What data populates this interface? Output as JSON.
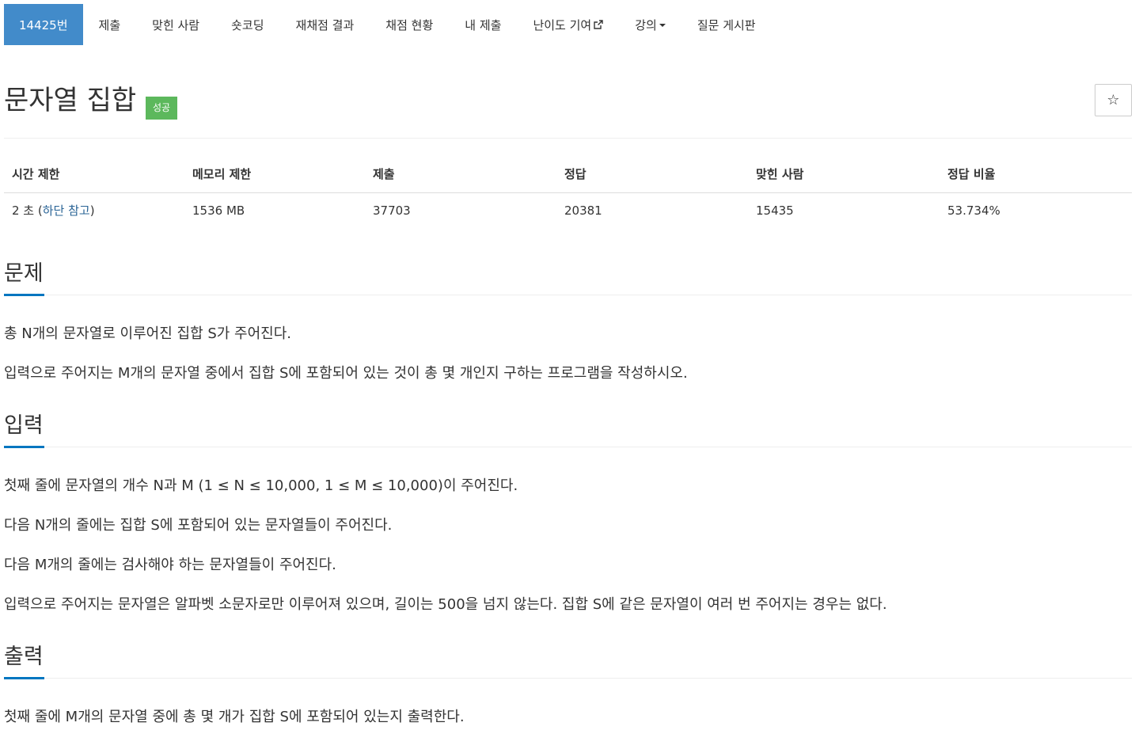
{
  "nav": {
    "tabs": [
      {
        "label": "14425번"
      },
      {
        "label": "제출"
      },
      {
        "label": "맞힌 사람"
      },
      {
        "label": "숏코딩"
      },
      {
        "label": "재채점 결과"
      },
      {
        "label": "채점 현황"
      },
      {
        "label": "내 제출"
      },
      {
        "label": "난이도 기여"
      },
      {
        "label": "강의"
      },
      {
        "label": "질문 게시판"
      }
    ],
    "accent_color": "#428bca"
  },
  "problem": {
    "title": "문자열 집합",
    "status_badge": "성공",
    "badge_color": "#5cb85c",
    "star_icon": "star-outline-icon",
    "star_glyph": "☆"
  },
  "info": {
    "headers": [
      "시간 제한",
      "메모리 제한",
      "제출",
      "정답",
      "맞힌 사람",
      "정답 비율"
    ],
    "time_limit_prefix": "2 초 (",
    "time_limit_link": "하단 참고",
    "time_limit_suffix": ")",
    "memory_limit": "1536 MB",
    "submissions": "37703",
    "accepted": "20381",
    "solvers": "15435",
    "ratio": "53.734%"
  },
  "sections": {
    "description": {
      "heading": "문제",
      "paragraphs": [
        "총 N개의 문자열로 이루어진 집합 S가 주어진다.",
        "입력으로 주어지는 M개의 문자열 중에서 집합 S에 포함되어 있는 것이 총 몇 개인지 구하는 프로그램을 작성하시오."
      ]
    },
    "input": {
      "heading": "입력",
      "paragraphs": [
        "첫째 줄에 문자열의 개수 N과 M (1 ≤ N ≤ 10,000, 1 ≤ M ≤ 10,000)이 주어진다.",
        "다음 N개의 줄에는 집합 S에 포함되어 있는 문자열들이 주어진다.",
        "다음 M개의 줄에는 검사해야 하는 문자열들이 주어진다.",
        "입력으로 주어지는 문자열은 알파벳 소문자로만 이루어져 있으며, 길이는 500을 넘지 않는다. 집합 S에 같은 문자열이 여러 번 주어지는 경우는 없다."
      ]
    },
    "output": {
      "heading": "출력",
      "paragraphs": [
        "첫째 줄에 M개의 문자열 중에 총 몇 개가 집합 S에 포함되어 있는지 출력한다."
      ]
    }
  }
}
